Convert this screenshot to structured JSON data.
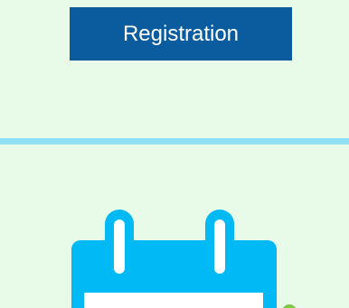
{
  "registration": {
    "button_label": "Registration"
  },
  "colors": {
    "background": "#e8fbe8",
    "button_background": "#0a5c9e",
    "button_text": "#ffffff",
    "divider": "#8fe0f5",
    "icon": "#00b9f5",
    "icon_inner": "#ffffff",
    "accent_dot": "#7ac943"
  },
  "icons": {
    "calendar": "calendar-icon"
  }
}
